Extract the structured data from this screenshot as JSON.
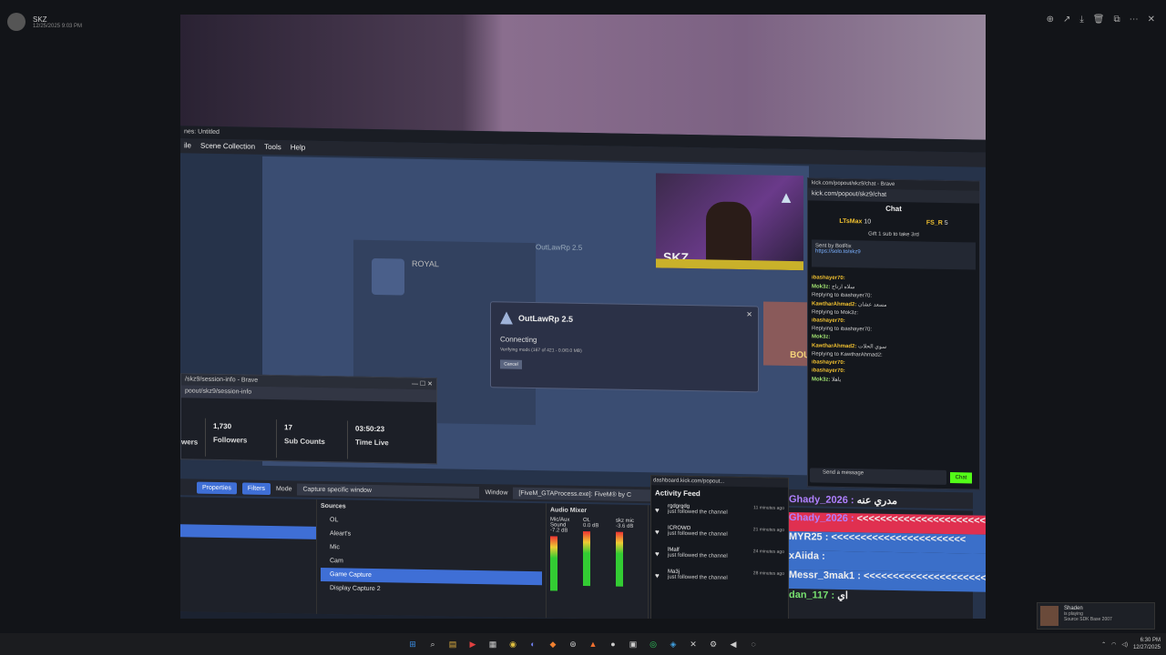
{
  "viewer": {
    "user": "SKZ",
    "date": "12/25/2025 9:03 PM"
  },
  "obs": {
    "title": "nes: Untitled",
    "menu": [
      "ile",
      "Scene Collection",
      "Tools",
      "Help"
    ],
    "properties": "Properties",
    "filters": "Filters",
    "mode_label": "Mode",
    "mode_value": "Capture specific window",
    "window_label": "Window",
    "window_value": "[FiveM_GTAProcess.exe]: FiveM® by C",
    "sources_title": "Sources",
    "sources": [
      "OL",
      "Aleart's",
      "Mic",
      "Cam",
      "Game Capture",
      "Display Capture 2"
    ],
    "mixer_title": "Audio Mixer",
    "mixer": [
      {
        "name": "Mic/Aux Sound",
        "db": "-7.2 dB"
      },
      {
        "name": "OL",
        "db": "0.0 dB"
      },
      {
        "name": "skz mic",
        "db": "-3.6 dB"
      }
    ]
  },
  "game": {
    "royal": "ROYAL",
    "outlaw": "OutLawRp 2.5",
    "bounties": "BOUNTIES"
  },
  "dialog": {
    "title": "OutLawRp 2.5",
    "status": "Connecting",
    "detail": "Verifying mods (167 of 421 - 0.0/0.0 MB)",
    "cancel": "Cancel"
  },
  "cam": {
    "tag": "SKZ"
  },
  "session": {
    "title": "/skz9/session-info - Brave",
    "url": "poout/skz9/session-info",
    "stats": [
      {
        "n": "1,730",
        "l": "Followers"
      },
      {
        "n": "17",
        "l": "Sub Counts"
      },
      {
        "n": "03:50:23",
        "l": "Time Live"
      }
    ],
    "left": "wers"
  },
  "chat": {
    "title": "kick.com/popout/skz9/chat - Brave",
    "url": "kick.com/popout/skz9/chat",
    "header": "Chat",
    "gifts": [
      {
        "name": "LTsMax",
        "n": "10"
      },
      {
        "name": "FS_R",
        "n": "5"
      }
    ],
    "gift_note": "Gift 1 sub to take 3rd",
    "pin_by": "Sent by BotRix",
    "pin_link": "https://solo.to/skz9",
    "messages": [
      {
        "u": "ibashayer70:",
        "t": ""
      },
      {
        "u": "Mok3z:",
        "t": "سلاه ارتاح"
      },
      {
        "u": "",
        "t": "Replying to ibashayer70:"
      },
      {
        "u": "KawtharAhmad2:",
        "t": "مسعد عشان"
      },
      {
        "u": "",
        "t": "Replying to Mok3z:"
      },
      {
        "u": "ibashayer70:",
        "t": ""
      },
      {
        "u": "",
        "t": "Replying to ibashayer70:"
      },
      {
        "u": "Mok3z:",
        "t": ""
      },
      {
        "u": "KawtharAhmad2:",
        "t": "سوي الحلات"
      },
      {
        "u": "",
        "t": "Replying to KawtharAhmad2:"
      },
      {
        "u": "ibashayer70:",
        "t": ""
      },
      {
        "u": "ibashayer70:",
        "t": ""
      },
      {
        "u": "Mok3z:",
        "t": "ياهلا"
      }
    ],
    "send": "Send a message",
    "chat_btn": "Chat"
  },
  "activity": {
    "url": "dashboard.kick.com/popout...",
    "title": "Activity Feed",
    "items": [
      {
        "who": "rgdgrgdg",
        "what": "just followed the channel",
        "when": "11 minutes ago"
      },
      {
        "who": "ICROWO",
        "what": "just followed the channel",
        "when": "21 minutes ago"
      },
      {
        "who": "lMalf",
        "what": "just followed the channel",
        "when": "24 minutes ago"
      },
      {
        "who": "Ma3j",
        "what": "just followed the channel",
        "when": "28 minutes ago"
      }
    ]
  },
  "overlay": [
    {
      "name": "Ghady_2026 :",
      "text": "مدري عنه"
    },
    {
      "name": "Ghady_2026 :",
      "text": "<<<<<<<<<<<<<<<<<<<<<<<<"
    },
    {
      "name": "MYR25 :",
      "text": "<<<<<<<<<<<<<<<<<<<<<<<"
    },
    {
      "name": "xAiida :",
      "text": ""
    },
    {
      "name": "Messr_3mak1 :",
      "text": "<<<<<<<<<<<<<<<<<<<<<<"
    },
    {
      "name": "dan_117 :",
      "text": "اي"
    }
  ],
  "notify": {
    "name": "Shaden",
    "status": "is playing",
    "game": "Source SDK Base 2007"
  },
  "taskbar": {
    "time": "6:30 PM",
    "date": "12/27/2025"
  }
}
